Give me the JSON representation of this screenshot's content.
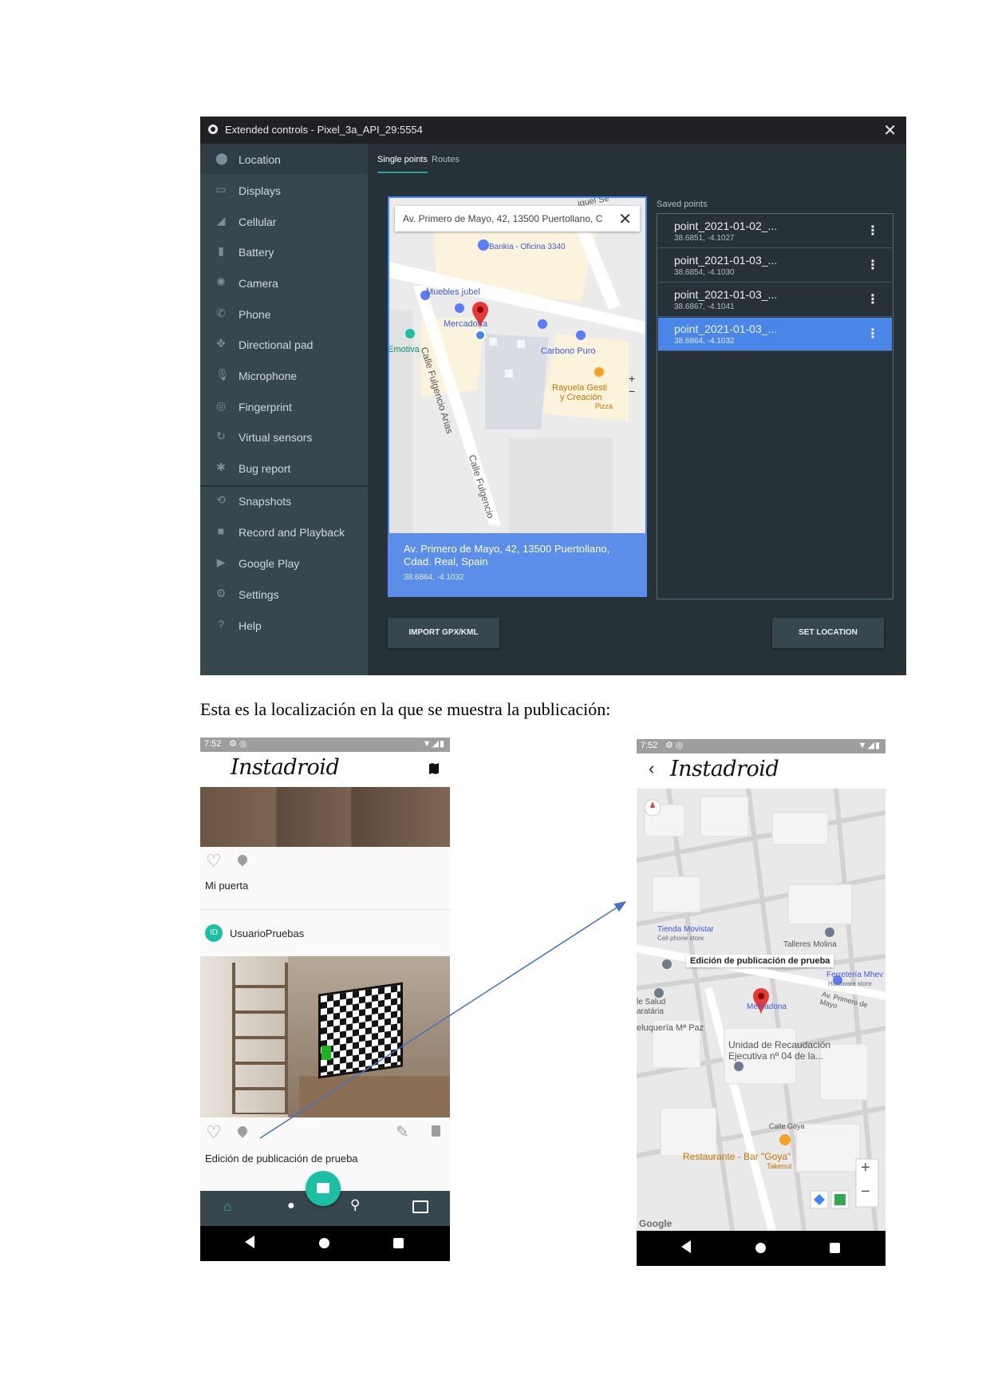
{
  "emulator": {
    "title": "Extended controls - Pixel_3a_API_29:5554",
    "close_glyph": "✕",
    "sidebar": [
      {
        "label": "Location",
        "icon": "location-pin-icon"
      },
      {
        "label": "Displays",
        "icon": "display-icon"
      },
      {
        "label": "Cellular",
        "icon": "cellular-signal-icon"
      },
      {
        "label": "Battery",
        "icon": "battery-icon"
      },
      {
        "label": "Camera",
        "icon": "camera-icon"
      },
      {
        "label": "Phone",
        "icon": "phone-icon"
      },
      {
        "label": "Directional pad",
        "icon": "dpad-icon"
      },
      {
        "label": "Microphone",
        "icon": "microphone-icon"
      },
      {
        "label": "Fingerprint",
        "icon": "fingerprint-icon"
      },
      {
        "label": "Virtual sensors",
        "icon": "sensors-icon"
      },
      {
        "label": "Bug report",
        "icon": "bug-icon"
      },
      {
        "label": "Snapshots",
        "icon": "history-icon"
      },
      {
        "label": "Record and Playback",
        "icon": "video-icon"
      },
      {
        "label": "Google Play",
        "icon": "play-icon"
      },
      {
        "label": "Settings",
        "icon": "gear-icon"
      },
      {
        "label": "Help",
        "icon": "help-icon"
      }
    ],
    "tabs": [
      "Single points",
      "Routes"
    ],
    "map": {
      "search_text": "Av. Primero de Mayo, 42, 13500 Puertollano, C",
      "labels": {
        "bankia": "Bankia - Oficina 3340",
        "muebles": "Muebles jubel",
        "mercadona": "Mercadona",
        "emotiva": "Emotiva",
        "carbono": "Carbono Puro",
        "rayuela1": "Rayuela Gesti",
        "rayuela2": "y Creación",
        "pizza": "Pizza",
        "street1": "Calle Fulgencio Arias",
        "street2": "Calle Fulgencio",
        "street_top": "iguel Se"
      },
      "zoom_in": "+",
      "zoom_out": "−"
    },
    "address_card": {
      "address": "Av. Primero de Mayo, 42, 13500 Puertollano, Cdad. Real, Spain",
      "coords": "38.6864, -4.1032"
    },
    "saved_points_label": "Saved points",
    "saved_points": [
      {
        "name": "point_2021-01-02_...",
        "coords": "38.6851, -4.1027",
        "selected": false
      },
      {
        "name": "point_2021-01-03_...",
        "coords": "38.6854, -4.1030",
        "selected": false
      },
      {
        "name": "point_2021-01-03_...",
        "coords": "38.6867, -4.1041",
        "selected": false
      },
      {
        "name": "point_2021-01-03_...",
        "coords": "38.6864, -4.1032",
        "selected": true
      }
    ],
    "menu_glyph": "⋮",
    "import_button": "IMPORT GPX/KML",
    "set_location_button": "SET LOCATION"
  },
  "caption": "Esta es la localización en la que se muestra la publicación:",
  "phone_left": {
    "status_time": "7:52",
    "status_icons": "▼◢▮",
    "brand": "Instadroid",
    "post1_caption": "Mi puerta",
    "user_initials": "ID",
    "username": "UsuarioPruebas",
    "post2_caption": "Edición de publicación de prueba"
  },
  "phone_right": {
    "status_time": "7:52",
    "status_icons": "▼◢▮",
    "back_glyph": "‹",
    "brand": "Instadroid",
    "map_labels": {
      "tienda1": "Tienda Movistar",
      "tienda2": "Cell phone store",
      "talleres": "Talleres Molina",
      "tooltip": "Edición de publicación de prueba",
      "ferreteria1": "Ferretería Mhev",
      "ferreteria2": "Hardware store",
      "salud1": "le Salud",
      "salud2": "aratária",
      "mercadona": "Mercadona",
      "primero": "Av. Primero de Mayo",
      "peluqueria": "eluquería Mª Paz",
      "unidad1": "Unidad de Recaudación",
      "unidad2": "Ejecutiva nº 04 de la...",
      "calle_goya": "Calle Goya",
      "restaurante": "Restaurante - Bar \"Goya\"",
      "takeout": "Takeout",
      "google": "Google",
      "zoom_in": "+",
      "zoom_out": "−"
    }
  },
  "colors": {
    "emulator_bg": "#263238",
    "sidebar_bg": "#37474f",
    "accent_teal": "#26a69a",
    "selected_blue": "#4a86e8",
    "fab_teal": "#1cbfa4",
    "nav_dark": "#37474f",
    "arrow_blue": "#4472c4"
  }
}
